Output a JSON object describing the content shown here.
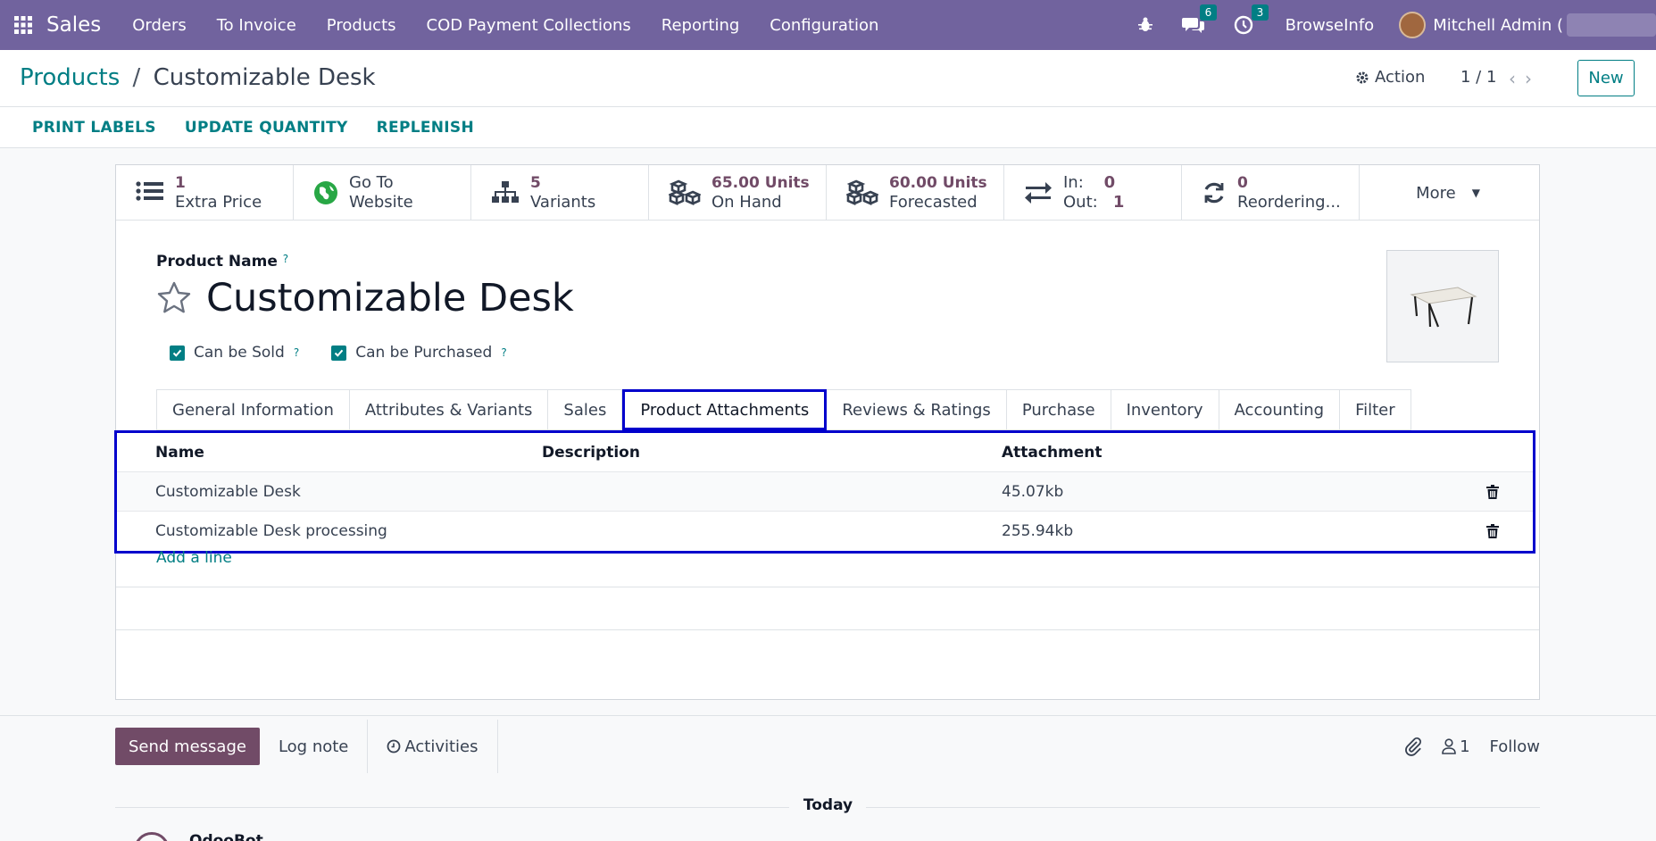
{
  "topbar": {
    "app_name": "Sales",
    "menu": [
      "Orders",
      "To Invoice",
      "Products",
      "COD Payment Collections",
      "Reporting",
      "Configuration"
    ],
    "messages_count": "6",
    "activities_count": "3",
    "company": "BrowseInfo",
    "user": "Mitchell Admin ("
  },
  "control": {
    "breadcrumb_parent": "Products",
    "breadcrumb_sep": "/",
    "breadcrumb_current": "Customizable Desk",
    "action_label": "Action",
    "pager": "1 / 1",
    "new_label": "New"
  },
  "statusbar": {
    "buttons": [
      "PRINT LABELS",
      "UPDATE QUANTITY",
      "REPLENISH"
    ]
  },
  "smart_buttons": [
    {
      "value": "1",
      "label": "Extra Price",
      "icon": "list-icon"
    },
    {
      "value": "Go To",
      "label": "Website",
      "icon": "globe-icon"
    },
    {
      "value": "5",
      "label": "Variants",
      "icon": "sitemap-icon"
    },
    {
      "value": "65.00 Units",
      "label": "On Hand",
      "icon": "cubes-icon"
    },
    {
      "value": "60.00 Units",
      "label": "Forecasted",
      "icon": "cubes-icon"
    },
    {
      "in_label": "In:",
      "in_value": "0",
      "out_label": "Out:",
      "out_value": "1",
      "icon": "exchange-icon"
    },
    {
      "value": "0",
      "label": "Reordering...",
      "icon": "refresh-icon"
    },
    {
      "label": "More"
    }
  ],
  "product": {
    "name_label": "Product Name",
    "help_mark": "?",
    "name": "Customizable Desk",
    "can_be_sold_label": "Can be Sold",
    "can_be_purchased_label": "Can be Purchased",
    "can_be_sold": true,
    "can_be_purchased": true
  },
  "tabs": [
    "General Information",
    "Attributes & Variants",
    "Sales",
    "Product Attachments",
    "Reviews & Ratings",
    "Purchase",
    "Inventory",
    "Accounting",
    "Filter"
  ],
  "active_tab": "Product Attachments",
  "attachments": {
    "headers": {
      "name": "Name",
      "description": "Description",
      "attachment": "Attachment"
    },
    "rows": [
      {
        "name": "Customizable Desk",
        "description": "",
        "attachment": "45.07kb"
      },
      {
        "name": "Customizable Desk processing",
        "description": "",
        "attachment": "255.94kb"
      }
    ],
    "add_line": "Add a line"
  },
  "chatter": {
    "send_message": "Send message",
    "log_note": "Log note",
    "activities": "Activities",
    "followers_count": "1",
    "follow": "Follow",
    "today": "Today",
    "author": "OdooBot"
  },
  "colors": {
    "topbar": "#71639e",
    "accent": "#017e84",
    "primary": "#714b67",
    "highlight": "#0000cc"
  }
}
